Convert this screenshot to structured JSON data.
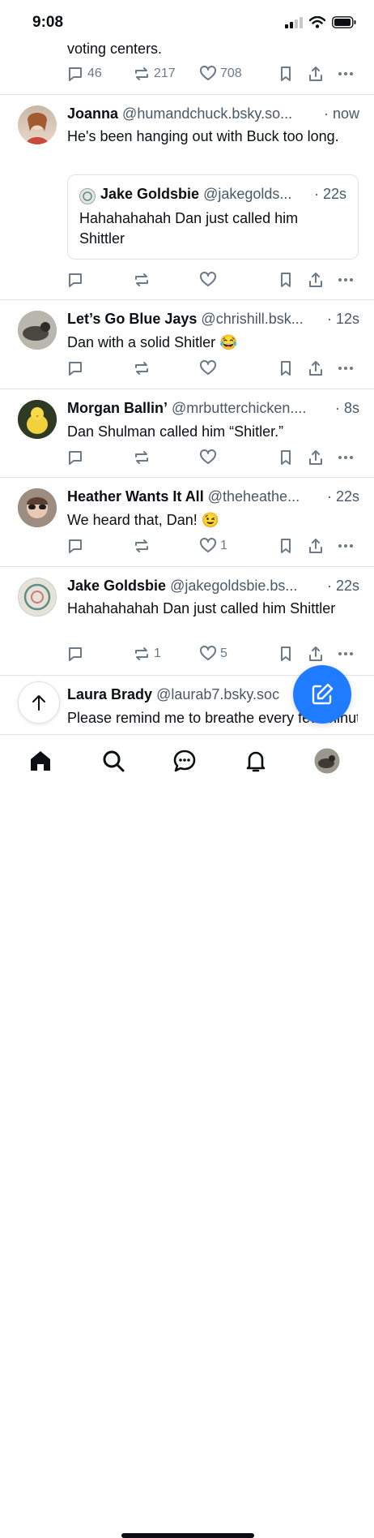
{
  "status": {
    "time": "9:08"
  },
  "feed": {
    "partial_post": {
      "text": "voting centers.",
      "replies": "46",
      "reposts": "217",
      "likes": "708"
    },
    "posts": [
      {
        "name": "Joanna",
        "handle": "@humandchuck.bsky.so...",
        "ago": "· now",
        "text": "He's been hanging out with Buck too long.",
        "quote": {
          "name": "Jake Goldsbie",
          "handle": "@jakegolds...",
          "ago": "· 22s",
          "text": "Hahahahahah Dan just called him Shittler"
        },
        "replies": "",
        "reposts": "",
        "likes": ""
      },
      {
        "name": "Let’s Go Blue Jays",
        "handle": "@chrishill.bsk...",
        "ago": "· 12s",
        "text": "Dan with a solid Shitler 😂",
        "replies": "",
        "reposts": "",
        "likes": ""
      },
      {
        "name": "Morgan Ballin’",
        "handle": "@mrbutterchicken....",
        "ago": "· 8s",
        "text": "Dan Shulman called him “Shitler.”",
        "replies": "",
        "reposts": "",
        "likes": ""
      },
      {
        "name": "Heather Wants It All",
        "handle": "@theheathe...",
        "ago": "· 22s",
        "text": "We heard that, Dan! 😉",
        "replies": "",
        "reposts": "",
        "likes": "1"
      },
      {
        "name": "Jake Goldsbie",
        "handle": "@jakegoldsbie.bs...",
        "ago": "· 22s",
        "text": "Hahahahahah Dan just called him Shittler",
        "replies": "",
        "reposts": "1",
        "likes": "5"
      },
      {
        "name": "Laura Brady",
        "handle": "@laurab7.bsky.soc",
        "ago": "",
        "text": "Please remind me to breathe every few minutes, if...",
        "replies": "",
        "reposts": "",
        "likes": ""
      }
    ]
  },
  "nav": {
    "tabs": [
      "home-icon",
      "search-icon",
      "chat-icon",
      "bell-icon",
      "profile-avatar"
    ]
  },
  "colors": {
    "accent": "#1f7bff",
    "muted": "#6b7a89",
    "handle": "#4a5866"
  }
}
